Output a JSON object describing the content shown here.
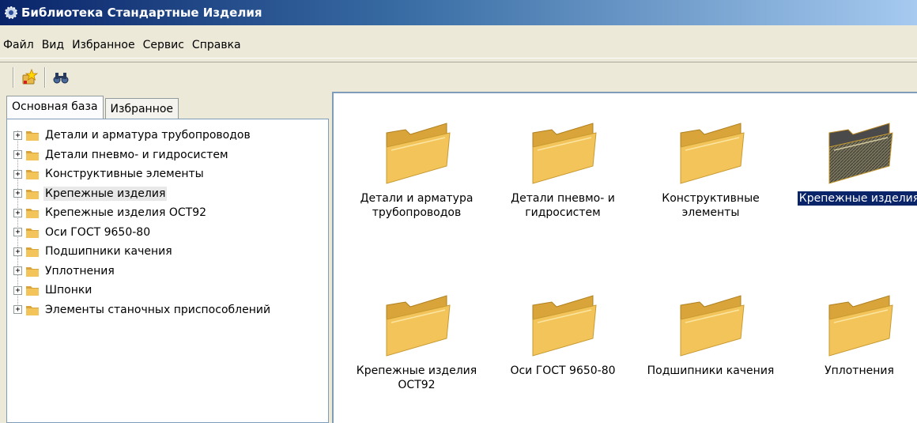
{
  "window": {
    "title": "Библиотека Стандартные Изделия"
  },
  "menu": [
    "Файл",
    "Вид",
    "Избранное",
    "Сервис",
    "Справка"
  ],
  "toolbar": {
    "buttons": [
      "add-favorite-icon",
      "find-binoculars-icon"
    ]
  },
  "tabs": [
    "Основная база",
    "Избранное"
  ],
  "tree": [
    {
      "label": "Детали и арматура трубопроводов",
      "highlighted": false
    },
    {
      "label": "Детали пневмо- и гидросистем",
      "highlighted": false
    },
    {
      "label": "Конструктивные элементы",
      "highlighted": false
    },
    {
      "label": "Крепежные изделия",
      "highlighted": true
    },
    {
      "label": "Крепежные изделия ОСТ92",
      "highlighted": false
    },
    {
      "label": "Оси ГОСТ 9650-80",
      "highlighted": false
    },
    {
      "label": "Подшипники качения",
      "highlighted": false
    },
    {
      "label": "Уплотнения",
      "highlighted": false
    },
    {
      "label": "Шпонки",
      "highlighted": false
    },
    {
      "label": "Элементы станочных приспособлений",
      "highlighted": false
    }
  ],
  "folders": [
    {
      "line1": "Детали и арматура",
      "line2": "трубопроводов",
      "selected": false
    },
    {
      "line1": "Детали пневмо- и",
      "line2": "гидросистем",
      "selected": false
    },
    {
      "line1": "Конструктивные",
      "line2": "элементы",
      "selected": false
    },
    {
      "line1": "Крепежные изделия",
      "line2": "",
      "selected": true
    },
    {
      "line1": "Крепежные изделия",
      "line2": "ОСТ92",
      "selected": false
    },
    {
      "line1": "Оси ГОСТ 9650-80",
      "line2": "",
      "selected": false
    },
    {
      "line1": "Подшипники качения",
      "line2": "",
      "selected": false
    },
    {
      "line1": "Уплотнения",
      "line2": "",
      "selected": false
    }
  ],
  "colors": {
    "selection": "#0a246a",
    "folder": "#f2c45a",
    "folder_dark": "#d9a53a"
  }
}
